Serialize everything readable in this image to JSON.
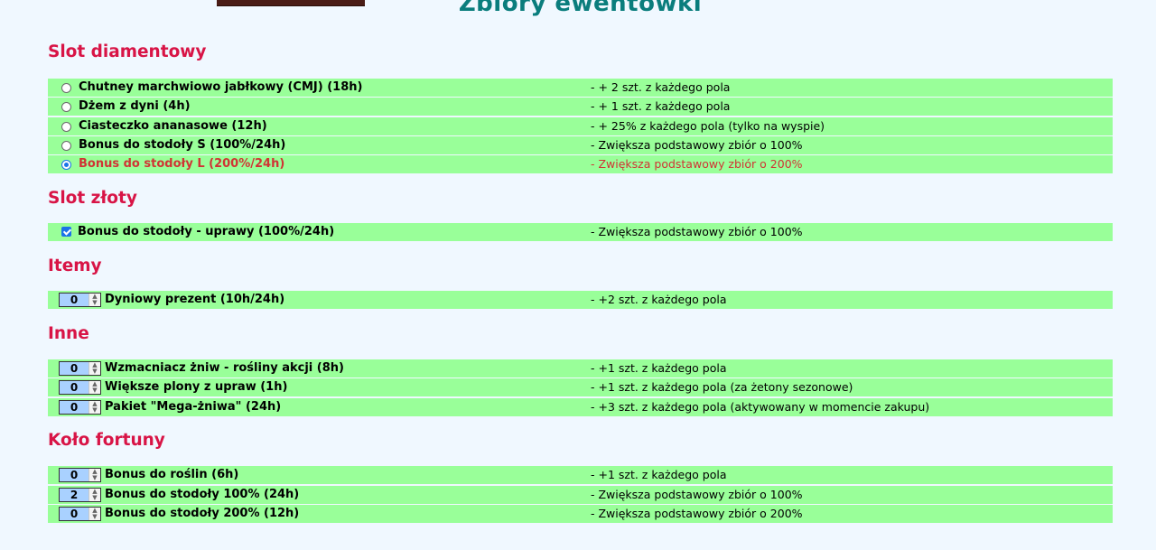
{
  "page_title": "Zbiory ewentówki",
  "sections": {
    "diamond": {
      "title": "Slot diamentowy",
      "items": [
        {
          "name": "Chutney marchwiowo jabłkowy (CMJ) (18h)",
          "desc": "- + 2 szt. z każdego pola",
          "selected": false
        },
        {
          "name": "Dżem z dyni (4h)",
          "desc": "- + 1 szt. z każdego pola",
          "selected": false
        },
        {
          "name": "Ciasteczko ananasowe (12h)",
          "desc": "- + 25% z każdego pola (tylko na wyspie)",
          "selected": false
        },
        {
          "name": "Bonus do stodoły S (100%/24h)",
          "desc": "- Zwiększa podstawowy zbiór o 100%",
          "selected": false
        },
        {
          "name": "Bonus do stodoły L (200%/24h)",
          "desc": "- Zwiększa podstawowy zbiór o 200%",
          "selected": true
        }
      ]
    },
    "gold": {
      "title": "Slot złoty",
      "items": [
        {
          "name": "Bonus do stodoły - uprawy (100%/24h)",
          "desc": "- Zwiększa podstawowy zbiór o 100%",
          "checked": true
        }
      ]
    },
    "items": {
      "title": "Itemy",
      "items": [
        {
          "name": "Dyniowy prezent (10h/24h)",
          "desc": "- +2 szt. z każdego pola",
          "qty": "0"
        }
      ]
    },
    "other": {
      "title": "Inne",
      "items": [
        {
          "name": "Wzmacniacz żniw - rośliny akcji (8h)",
          "desc": "- +1 szt. z każdego pola",
          "qty": "0"
        },
        {
          "name": "Większe plony z upraw (1h)",
          "desc": "- +1 szt. z każdego pola (za żetony sezonowe)",
          "qty": "0"
        },
        {
          "name": "Pakiet \"Mega-żniwa\" (24h)",
          "desc": "- +3 szt. z każdego pola (aktywowany w momencie zakupu)",
          "qty": "0"
        }
      ]
    },
    "wheel": {
      "title": "Koło fortuny",
      "items": [
        {
          "name": "Bonus do roślin (6h)",
          "desc": "- +1 szt. z każdego pola",
          "qty": "0"
        },
        {
          "name": "Bonus do stodoły 100% (24h)",
          "desc": "- Zwiększa podstawowy zbiór o 100%",
          "qty": "2"
        },
        {
          "name": "Bonus do stodoły 200% (12h)",
          "desc": "- Zwiększa podstawowy zbiór o 200%",
          "qty": "0"
        }
      ]
    }
  },
  "colors": {
    "background": "#f0f8ff",
    "row_background": "#99ff99",
    "section_title": "#d81446",
    "page_title": "#0a7d7d",
    "selected_text": "#d03434",
    "input_background": "#a9d1ff"
  }
}
